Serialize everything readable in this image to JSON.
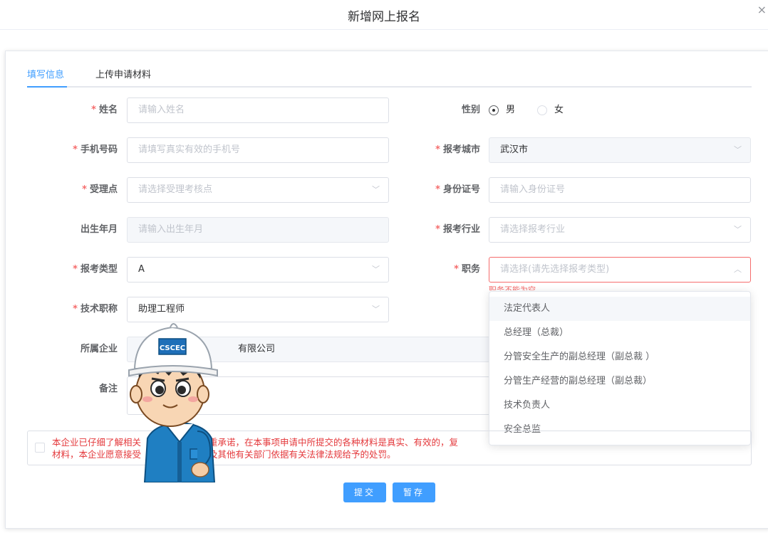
{
  "dialog": {
    "title": "新增网上报名",
    "close": "×"
  },
  "tabs": [
    {
      "label": "填写信息"
    },
    {
      "label": "上传申请材料"
    }
  ],
  "form": {
    "name": {
      "label": "姓名",
      "required": "*",
      "placeholder": "请输入姓名"
    },
    "gender": {
      "label": "性别",
      "options": [
        "男",
        "女"
      ],
      "selected": "男"
    },
    "phone": {
      "label": "手机号码",
      "required": "*",
      "placeholder": "请填写真实有效的手机号"
    },
    "city": {
      "label": "报考城市",
      "required": "*",
      "value": "武汉市"
    },
    "site": {
      "label": "受理点",
      "required": "*",
      "placeholder": "请选择受理考核点"
    },
    "idcard": {
      "label": "身份证号",
      "required": "*",
      "placeholder": "请输入身份证号"
    },
    "birth": {
      "label": "出生年月",
      "placeholder": "请输入出生年月"
    },
    "industry": {
      "label": "报考行业",
      "required": "*",
      "placeholder": "请选择报考行业"
    },
    "type": {
      "label": "报考类型",
      "required": "*",
      "value": "A"
    },
    "position": {
      "label": "职务",
      "required": "*",
      "placeholder": "请选择(请先选择报考类型)",
      "error": "职务不能为空"
    },
    "title": {
      "label": "技术职称",
      "required": "*",
      "value": "助理工程师"
    },
    "company": {
      "label": "所属企业",
      "value": "有限公司"
    },
    "remark": {
      "label": "备注"
    }
  },
  "position_options": [
    "法定代表人",
    "总经理（总裁）",
    "分管安全生产的副总经理（副总裁 ）",
    "分管生产经营的副总经理（副总裁）",
    "技术负责人",
    "安全总监"
  ],
  "agreement": {
    "line1": "本企业已仔细了解相关",
    "line1b": "重承诺，在本事项申请中所提交的各种材料是真实、有效的，复",
    "line2": "材料，本企业愿意接受",
    "line2b": "及其他有关部门依据有关法律法规给予的处罚。"
  },
  "buttons": {
    "submit": "提交",
    "save": "暂存"
  },
  "mascot": {
    "badge": "CSCEC"
  },
  "colors": {
    "accent": "#409eff",
    "error": "#f56c6c",
    "required": "#f56c6c"
  }
}
